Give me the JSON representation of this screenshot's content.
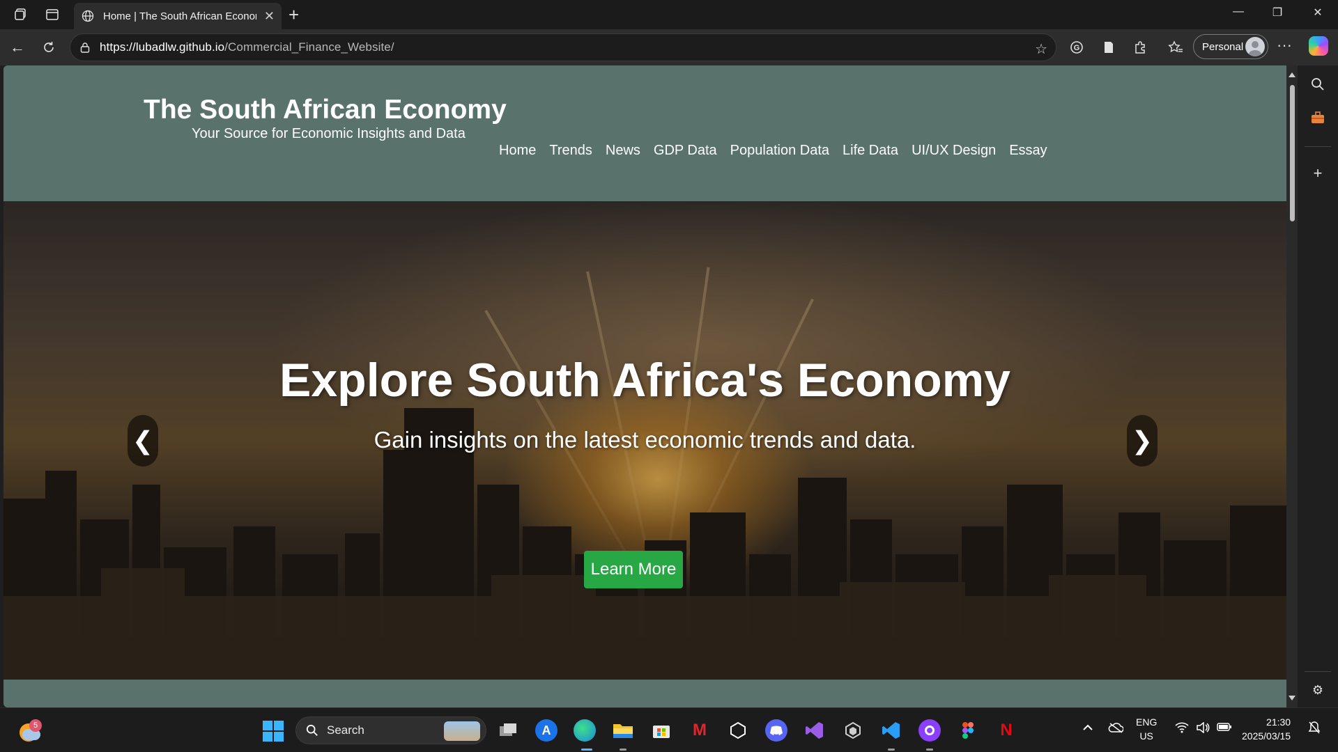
{
  "browser": {
    "tab_title": "Home | The South African Econom",
    "url_host": "https://lubadlw.github.io",
    "url_path": "/Commercial_Finance_Website/",
    "profile_label": "Personal",
    "more_label": "···"
  },
  "site": {
    "title": "The South African Economy",
    "subtitle": "Your Source for Economic Insights and Data",
    "nav": [
      "Home",
      "Trends",
      "News",
      "GDP Data",
      "Population Data",
      "Life Data",
      "UI/UX Design",
      "Essay"
    ]
  },
  "hero": {
    "title": "Explore South Africa's Economy",
    "subtitle": "Gain insights on the latest economic trends and data.",
    "button": "Learn More",
    "prev_glyph": "❮",
    "next_glyph": "❯"
  },
  "taskbar": {
    "weather_badge": "5",
    "search_label": "Search",
    "lang_line1": "ENG",
    "lang_line2": "US",
    "time": "21:30",
    "date": "2025/03/15"
  },
  "colors": {
    "header_bg": "#5a726c",
    "cta_green": "#28a745",
    "chrome_dark": "#1b1b1b"
  }
}
